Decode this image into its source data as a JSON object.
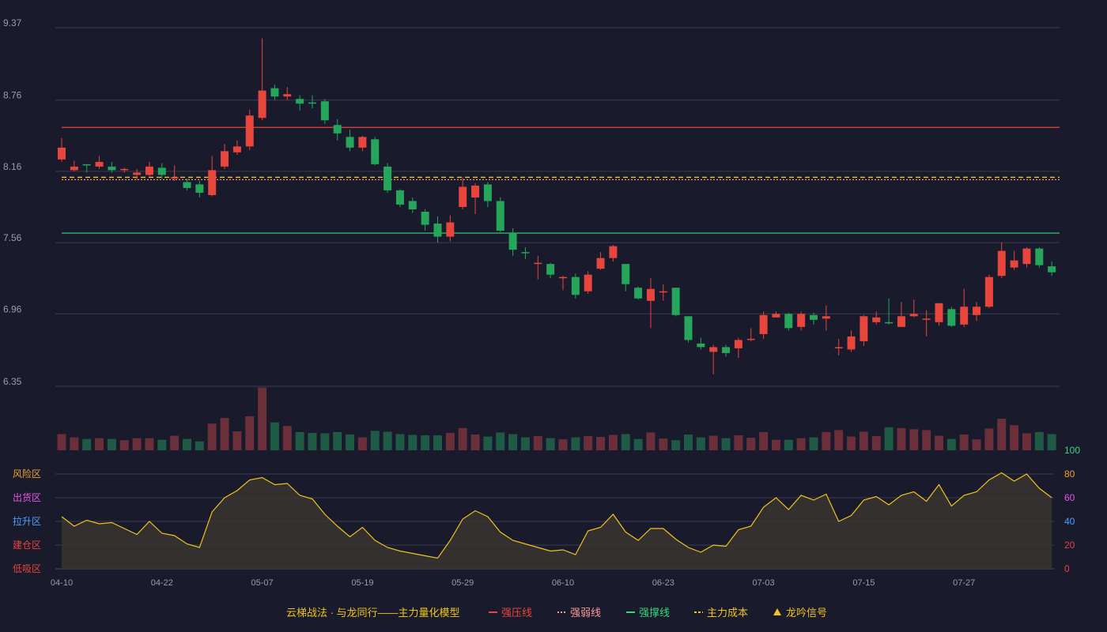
{
  "chart_data": {
    "type": "candlestick",
    "price_axis": {
      "ticks": [
        9.37,
        8.76,
        8.16,
        7.56,
        6.96,
        6.35
      ],
      "ylim": [
        6.35,
        9.37
      ]
    },
    "x_ticks": [
      "04-10",
      "04-22",
      "05-07",
      "05-19",
      "05-29",
      "06-10",
      "06-23",
      "07-03",
      "07-15",
      "07-27"
    ],
    "x_tick_index": [
      0,
      8,
      16,
      24,
      32,
      40,
      48,
      56,
      64,
      72
    ],
    "candles": [
      [
        8.26,
        8.36,
        8.44,
        8.24
      ],
      [
        8.17,
        8.2,
        8.25,
        8.16
      ],
      [
        8.22,
        8.21,
        8.22,
        8.15
      ],
      [
        8.2,
        8.24,
        8.29,
        8.18
      ],
      [
        8.2,
        8.17,
        8.24,
        8.15
      ],
      [
        8.17,
        8.18,
        8.19,
        8.15
      ],
      [
        8.13,
        8.15,
        8.18,
        8.09
      ],
      [
        8.13,
        8.2,
        8.24,
        8.12
      ],
      [
        8.19,
        8.13,
        8.23,
        8.1
      ],
      [
        8.1,
        8.11,
        8.21,
        8.08
      ],
      [
        8.07,
        8.02,
        8.1,
        8.0
      ],
      [
        8.05,
        7.98,
        8.08,
        7.94
      ],
      [
        7.96,
        8.17,
        8.29,
        7.95
      ],
      [
        8.2,
        8.33,
        8.39,
        8.18
      ],
      [
        8.32,
        8.37,
        8.42,
        8.3
      ],
      [
        8.37,
        8.63,
        8.68,
        8.34
      ],
      [
        8.61,
        8.84,
        9.28,
        8.59
      ],
      [
        8.86,
        8.79,
        8.89,
        8.76
      ],
      [
        8.79,
        8.81,
        8.87,
        8.76
      ],
      [
        8.77,
        8.73,
        8.8,
        8.67
      ],
      [
        8.74,
        8.73,
        8.8,
        8.69
      ],
      [
        8.75,
        8.59,
        8.77,
        8.56
      ],
      [
        8.55,
        8.48,
        8.6,
        8.42
      ],
      [
        8.45,
        8.36,
        8.51,
        8.33
      ],
      [
        8.36,
        8.45,
        8.46,
        8.33
      ],
      [
        8.43,
        8.22,
        8.45,
        8.21
      ],
      [
        8.2,
        8.0,
        8.23,
        7.98
      ],
      [
        8.0,
        7.88,
        8.01,
        7.86
      ],
      [
        7.91,
        7.84,
        7.94,
        7.81
      ],
      [
        7.82,
        7.71,
        7.84,
        7.66
      ],
      [
        7.72,
        7.61,
        7.78,
        7.56
      ],
      [
        7.61,
        7.73,
        7.79,
        7.57
      ],
      [
        7.86,
        8.03,
        8.11,
        7.84
      ],
      [
        7.94,
        8.04,
        8.06,
        7.8
      ],
      [
        8.05,
        7.91,
        8.07,
        7.86
      ],
      [
        7.91,
        7.66,
        7.94,
        7.65
      ],
      [
        7.64,
        7.5,
        7.68,
        7.45
      ],
      [
        7.48,
        7.47,
        7.52,
        7.42
      ],
      [
        7.39,
        7.39,
        7.45,
        7.25
      ],
      [
        7.38,
        7.29,
        7.39,
        7.26
      ],
      [
        7.27,
        7.27,
        7.28,
        7.16
      ],
      [
        7.27,
        7.12,
        7.3,
        7.09
      ],
      [
        7.15,
        7.29,
        7.32,
        7.13
      ],
      [
        7.34,
        7.43,
        7.48,
        7.33
      ],
      [
        7.43,
        7.53,
        7.54,
        7.4
      ],
      [
        7.38,
        7.21,
        7.38,
        7.15
      ],
      [
        7.18,
        7.09,
        7.19,
        7.08
      ],
      [
        7.07,
        7.17,
        7.26,
        6.84
      ],
      [
        7.15,
        7.15,
        7.21,
        7.07
      ],
      [
        7.18,
        6.95,
        7.18,
        6.94
      ],
      [
        6.94,
        6.74,
        6.94,
        6.72
      ],
      [
        6.71,
        6.68,
        6.76,
        6.66
      ],
      [
        6.64,
        6.68,
        6.7,
        6.45
      ],
      [
        6.68,
        6.63,
        6.7,
        6.6
      ],
      [
        6.67,
        6.74,
        6.76,
        6.59
      ],
      [
        6.75,
        6.75,
        6.84,
        6.73
      ],
      [
        6.79,
        6.95,
        6.98,
        6.75
      ],
      [
        6.93,
        6.96,
        6.98,
        6.93
      ],
      [
        6.96,
        6.84,
        6.97,
        6.82
      ],
      [
        6.85,
        6.96,
        6.98,
        6.82
      ],
      [
        6.95,
        6.91,
        6.97,
        6.87
      ],
      [
        6.92,
        6.94,
        7.03,
        6.82
      ],
      [
        6.68,
        6.68,
        6.75,
        6.61
      ],
      [
        6.66,
        6.77,
        6.82,
        6.64
      ],
      [
        6.73,
        6.94,
        6.95,
        6.69
      ],
      [
        6.89,
        6.93,
        6.98,
        6.87
      ],
      [
        6.89,
        6.88,
        7.09,
        6.87
      ],
      [
        6.85,
        6.94,
        7.06,
        6.85
      ],
      [
        6.94,
        6.96,
        7.08,
        6.93
      ],
      [
        6.92,
        6.92,
        6.99,
        6.77
      ],
      [
        6.89,
        7.05,
        7.05,
        6.86
      ],
      [
        7.0,
        6.86,
        7.02,
        6.85
      ],
      [
        6.87,
        7.02,
        7.17,
        6.85
      ],
      [
        6.95,
        7.02,
        7.06,
        6.9
      ],
      [
        7.02,
        7.27,
        7.29,
        7.01
      ],
      [
        7.28,
        7.49,
        7.56,
        7.26
      ],
      [
        7.35,
        7.41,
        7.49,
        7.33
      ],
      [
        7.38,
        7.51,
        7.52,
        7.35
      ],
      [
        7.51,
        7.37,
        7.52,
        7.35
      ],
      [
        7.36,
        7.31,
        7.4,
        7.28
      ]
    ],
    "lines": {
      "strong_pressure": {
        "value": 8.53,
        "color": "#e8453c"
      },
      "weak_line": {
        "value": 8.09,
        "color": "#ff9a9a"
      },
      "strong_support": {
        "value": 7.64,
        "color": "#37d67a"
      },
      "main_cost": {
        "value": 8.11,
        "color": "#f0c419"
      }
    },
    "volume": [
      40,
      32,
      28,
      30,
      28,
      25,
      30,
      30,
      26,
      36,
      28,
      22,
      66,
      80,
      47,
      84,
      155,
      69,
      60,
      45,
      43,
      42,
      45,
      39,
      32,
      48,
      46,
      40,
      38,
      37,
      37,
      43,
      55,
      39,
      34,
      44,
      40,
      32,
      35,
      30,
      27,
      32,
      35,
      33,
      38,
      40,
      28,
      44,
      29,
      25,
      39,
      32,
      36,
      30,
      37,
      31,
      45,
      26,
      26,
      30,
      32,
      45,
      50,
      34,
      46,
      35,
      57,
      55,
      52,
      50,
      36,
      28,
      39,
      27,
      54,
      78,
      62,
      42,
      45,
      40
    ],
    "volume_ymax": 160,
    "indicator": {
      "axis_ticks": [
        0,
        20,
        40,
        60,
        80,
        100
      ],
      "axis_colors": [
        "#e8453c",
        "#e8453c",
        "#4aa0ff",
        "#e855e8",
        "#f0a030",
        "#37d67a"
      ],
      "zones": [
        {
          "label": "风险区",
          "color": "#f0a030"
        },
        {
          "label": "出货区",
          "color": "#e855e8"
        },
        {
          "label": "拉升区",
          "color": "#4aa0ff"
        },
        {
          "label": "建仓区",
          "color": "#e8453c"
        },
        {
          "label": "低吸区",
          "color": "#e8453c"
        }
      ],
      "values": [
        44,
        36,
        41,
        38,
        39,
        34,
        29,
        40,
        30,
        28,
        21,
        18,
        48,
        60,
        66,
        75,
        77,
        71,
        72,
        62,
        59,
        46,
        36,
        27,
        35,
        24,
        18,
        15,
        13,
        11,
        9,
        24,
        42,
        49,
        44,
        31,
        24,
        21,
        18,
        15,
        16,
        12,
        32,
        35,
        46,
        31,
        24,
        34,
        34,
        25,
        18,
        14,
        20,
        19,
        33,
        36,
        52,
        60,
        50,
        62,
        58,
        63,
        40,
        45,
        58,
        61,
        54,
        62,
        65,
        57,
        71,
        53,
        62,
        65,
        75,
        81,
        74,
        80,
        68,
        60
      ],
      "line_color": "#f0c419"
    },
    "colors": {
      "up": "#e8453c",
      "down": "#26a65b",
      "up_volume": "#6b2f3a",
      "down_volume": "#1f5a45"
    }
  },
  "legend": {
    "title": "云梯战法 · 与龙同行——主力量化模型",
    "items": [
      {
        "label": "强压线",
        "color": "#e8453c",
        "style": "solid"
      },
      {
        "label": "强弱线",
        "color": "#ff9a9a",
        "style": "dotted"
      },
      {
        "label": "强撑线",
        "color": "#37d67a",
        "style": "solid"
      },
      {
        "label": "主力成本",
        "color": "#f0c419",
        "style": "dashed"
      },
      {
        "label": "龙吟信号",
        "color": "#f0c419",
        "style": "triangle"
      }
    ]
  }
}
